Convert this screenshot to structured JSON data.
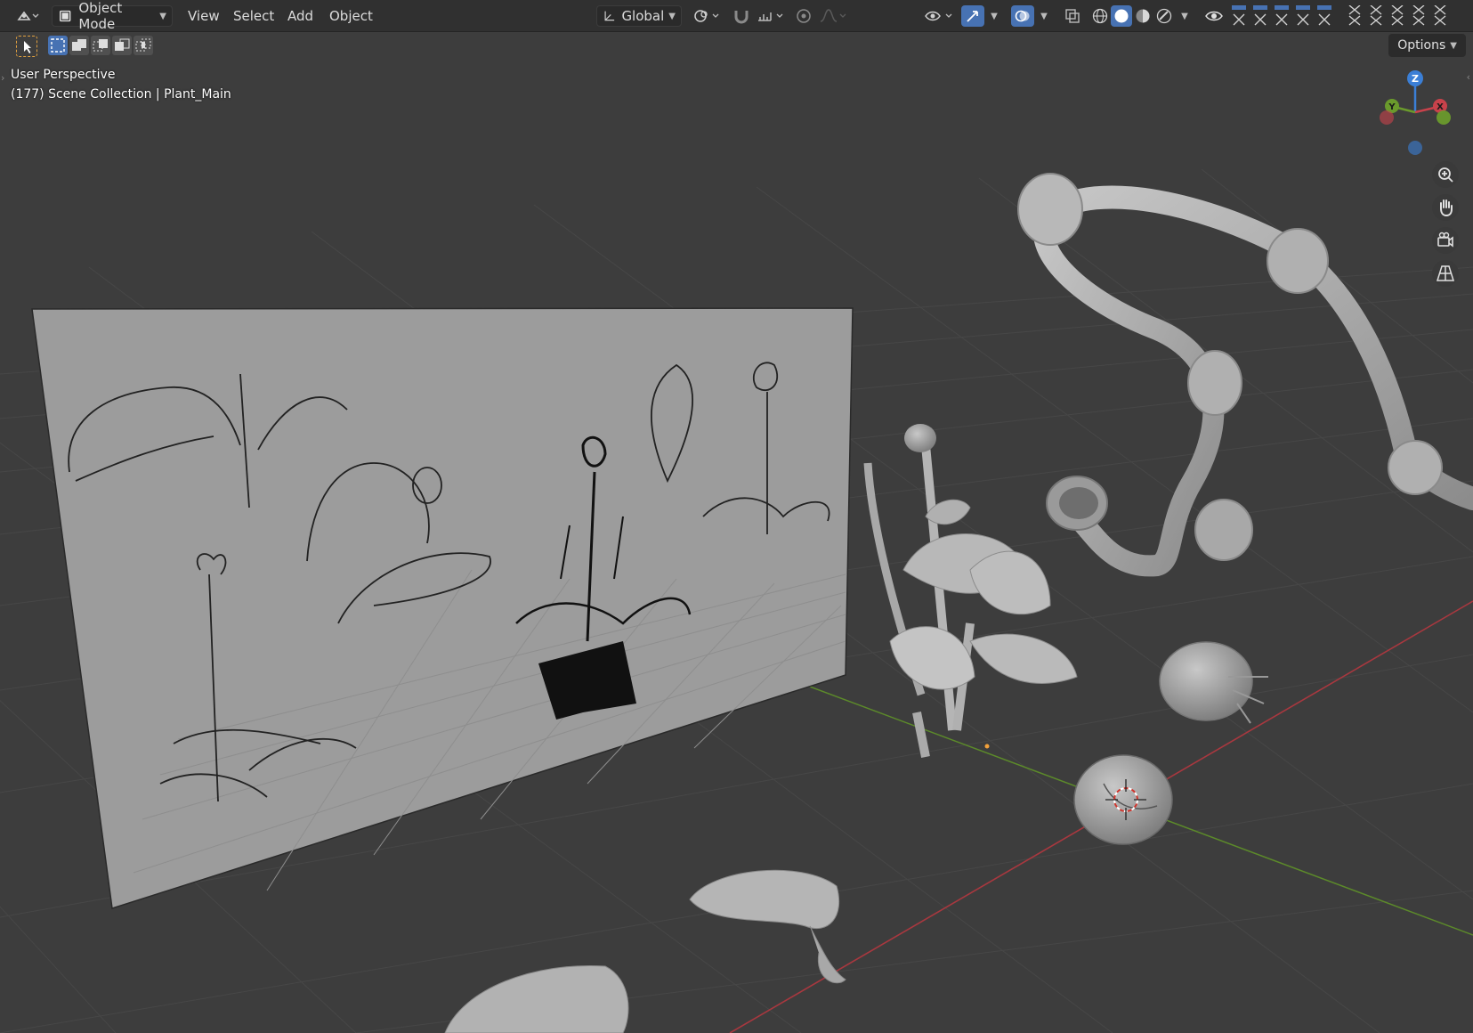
{
  "header": {
    "mode_label": "Object Mode",
    "menus": [
      "View",
      "Select",
      "Add",
      "Object"
    ],
    "transform_orientation": "Global",
    "options_label": "Options"
  },
  "viewport": {
    "view_name": "User Perspective",
    "frame_info": "(177) Scene Collection | Plant_Main",
    "gizmo_axes": {
      "z": "Z",
      "y": "Y",
      "x": "X"
    }
  },
  "icons": {
    "editor_type": "view3d-editor-icon",
    "object_mode": "object-mode-icon",
    "transform_orientation": "orientation-icon",
    "pivot": "pivot-point-icon",
    "snap": "snap-magnet-icon",
    "proportional": "proportional-edit-icon",
    "visibility": "eye-icon",
    "gizmo": "gizmo-icon",
    "overlays": "overlays-icon",
    "xray": "xray-icon",
    "shading": [
      "wireframe-icon",
      "solid-icon",
      "material-icon",
      "rendered-icon"
    ],
    "zoom": "zoom-icon",
    "pan": "hand-icon",
    "camera": "camera-icon",
    "perspective": "grid-perspective-icon"
  },
  "colors": {
    "accent_blue": "#4772b3",
    "axis_x": "#c8424b",
    "axis_y": "#6a9a2c",
    "axis_z": "#3b7fd6",
    "header_bg": "#303030",
    "viewport_bg": "#3d3d3d"
  }
}
